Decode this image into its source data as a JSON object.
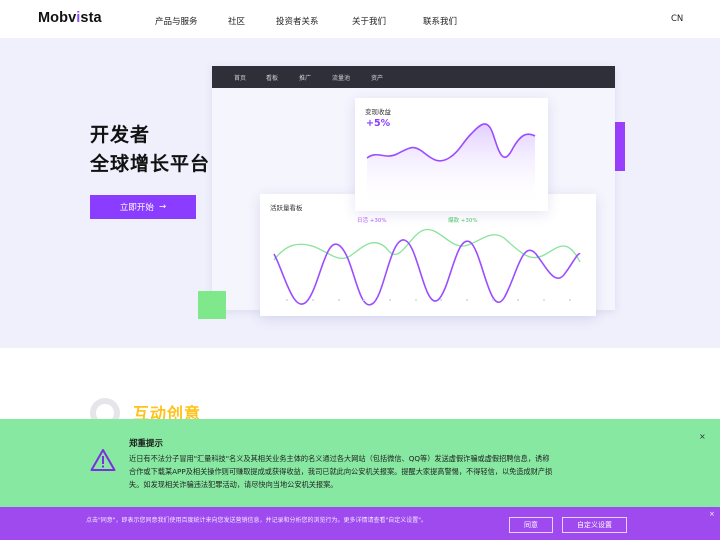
{
  "header": {
    "logo_prefix": "Mobv",
    "logo_accent": "i",
    "logo_suffix": "sta",
    "nav": [
      "产品与服务",
      "社区",
      "投资者关系",
      "关于我们",
      "联系我们"
    ],
    "lang": "CN"
  },
  "hero": {
    "title_line1": "开发者",
    "title_line2": "全球增长平台",
    "cta_label": "立即开始",
    "cta_arrow": "→",
    "dashboard": {
      "tabs": [
        "首页",
        "看板",
        "推广",
        "流量池",
        "资产"
      ],
      "revenue_card": {
        "title": "变现收益",
        "change": "+5%"
      },
      "active_card": {
        "title": "活跃量看板",
        "legend_a": "日活 +30%",
        "legend_b": "爆款 +30%"
      }
    }
  },
  "section": {
    "title": "互动创意"
  },
  "notice": {
    "title": "郑重提示",
    "lines": [
      "近日有不法分子冒用\"汇量科技\"名义及其相关业务主体的名义通过各大网站（包括微信、QQ等）发送虚假诈骗或虚假招聘信息，诱称",
      "合作或下载某APP及相关操作则可赚取提成或获得收益，我司已就此向公安机关报案。提醒大家提高警惕，不得轻信，以免造成财产损",
      "失。如发现相关诈骗违法犯罪活动，请尽快向当地公安机关报案。"
    ],
    "close": "×"
  },
  "cookie": {
    "text": "点击\"同意\"，即表示您同意我们使用百度统计来向您发送营销信息，并记录和分析您的浏览行为。更多详情请查看\"自定义设置\"。",
    "agree": "同意",
    "customize": "自定义设置",
    "close": "×"
  },
  "colors": {
    "brand_purple": "#8b3dff",
    "hero_bg": "#eff0fc",
    "notice_green": "#87e9a1",
    "cookie_purple": "#9e4aee",
    "accent_yellow": "#ffc21a"
  }
}
